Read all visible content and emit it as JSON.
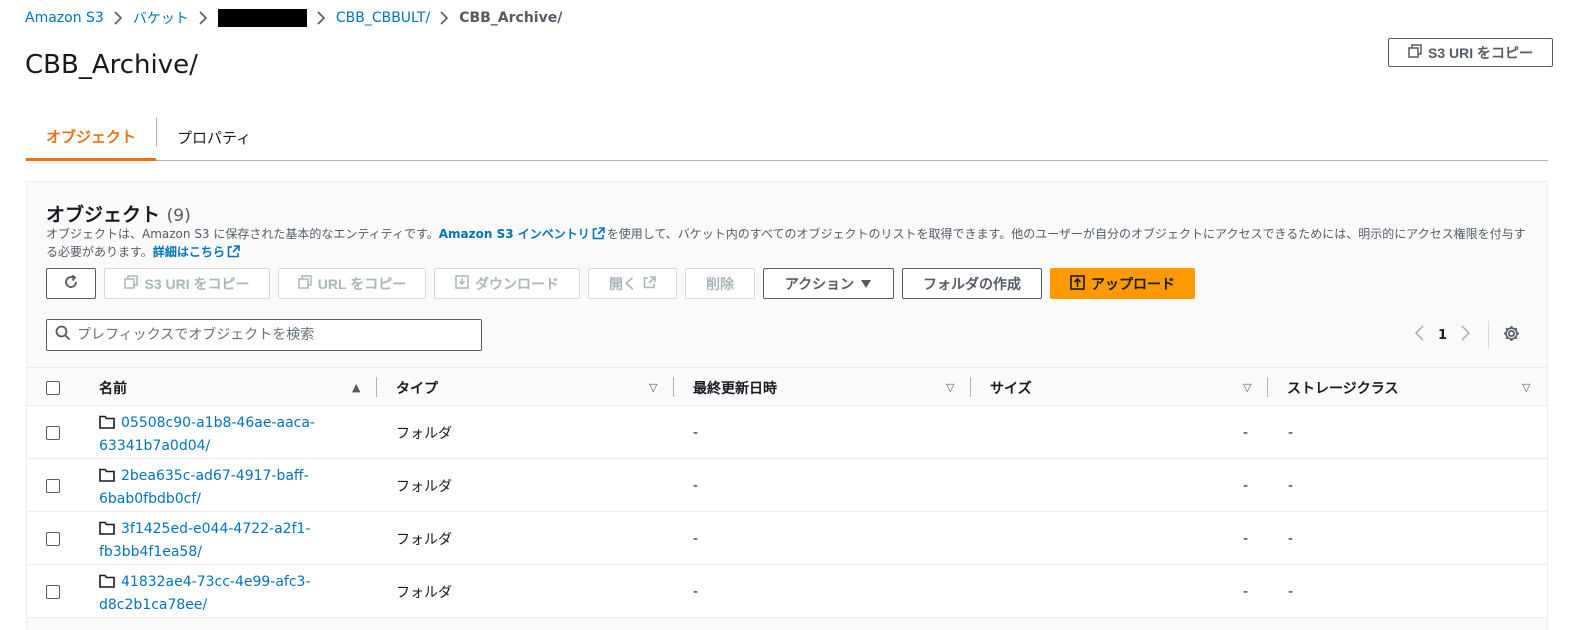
{
  "breadcrumb": {
    "items": [
      "Amazon S3",
      "バケット",
      "CBB_CBBULT/"
    ],
    "current": "CBB_Archive/"
  },
  "header": {
    "title": "CBB_Archive/",
    "copy_uri_label": "S3 URI をコピー"
  },
  "tabs": [
    {
      "label": "オブジェクト",
      "active": true
    },
    {
      "label": "プロパティ",
      "active": false
    }
  ],
  "panel": {
    "heading": "オブジェクト",
    "count": "(9)",
    "desc_part1": "オブジェクトは、Amazon S3 に保存された基本的なエンティティです。",
    "desc_link1": "Amazon S3 インベントリ",
    "desc_part2": "を使用して、バケット内のすべてのオブジェクトのリストを取得できます。他のユーザーが自分のオブジェクトにアクセスできるためには、明示的にアクセス権限を付与する必要があります。",
    "desc_link2": "詳細はこちら"
  },
  "toolbar": {
    "copy_s3_uri": "S3 URI をコピー",
    "copy_url": "URL をコピー",
    "download": "ダウンロード",
    "open": "開く",
    "delete": "削除",
    "actions": "アクション",
    "create_folder": "フォルダの作成",
    "upload": "アップロード"
  },
  "search": {
    "placeholder": "プレフィックスでオブジェクトを検索"
  },
  "pagination": {
    "page": "1"
  },
  "table": {
    "columns": [
      "名前",
      "タイプ",
      "最終更新日時",
      "サイズ",
      "ストレージクラス"
    ],
    "rows": [
      {
        "name_line1": "05508c90-a1b8-46ae-aaca-",
        "name_line2": "63341b7a0d04/",
        "type": "フォルダ",
        "modified": "-",
        "size": "-",
        "storage": "-"
      },
      {
        "name_line1": "2bea635c-ad67-4917-baff-",
        "name_line2": "6bab0fbdb0cf/",
        "type": "フォルダ",
        "modified": "-",
        "size": "-",
        "storage": "-"
      },
      {
        "name_line1": "3f1425ed-e044-4722-a2f1-",
        "name_line2": "fb3bb4f1ea58/",
        "type": "フォルダ",
        "modified": "-",
        "size": "-",
        "storage": "-"
      },
      {
        "name_line1": "41832ae4-73cc-4e99-afc3-",
        "name_line2": "d8c2b1ca78ee/",
        "type": "フォルダ",
        "modified": "-",
        "size": "-",
        "storage": "-"
      }
    ]
  },
  "colors": {
    "link": "#0073bb",
    "accent": "#ec7211",
    "primary_button": "#ff9900"
  }
}
